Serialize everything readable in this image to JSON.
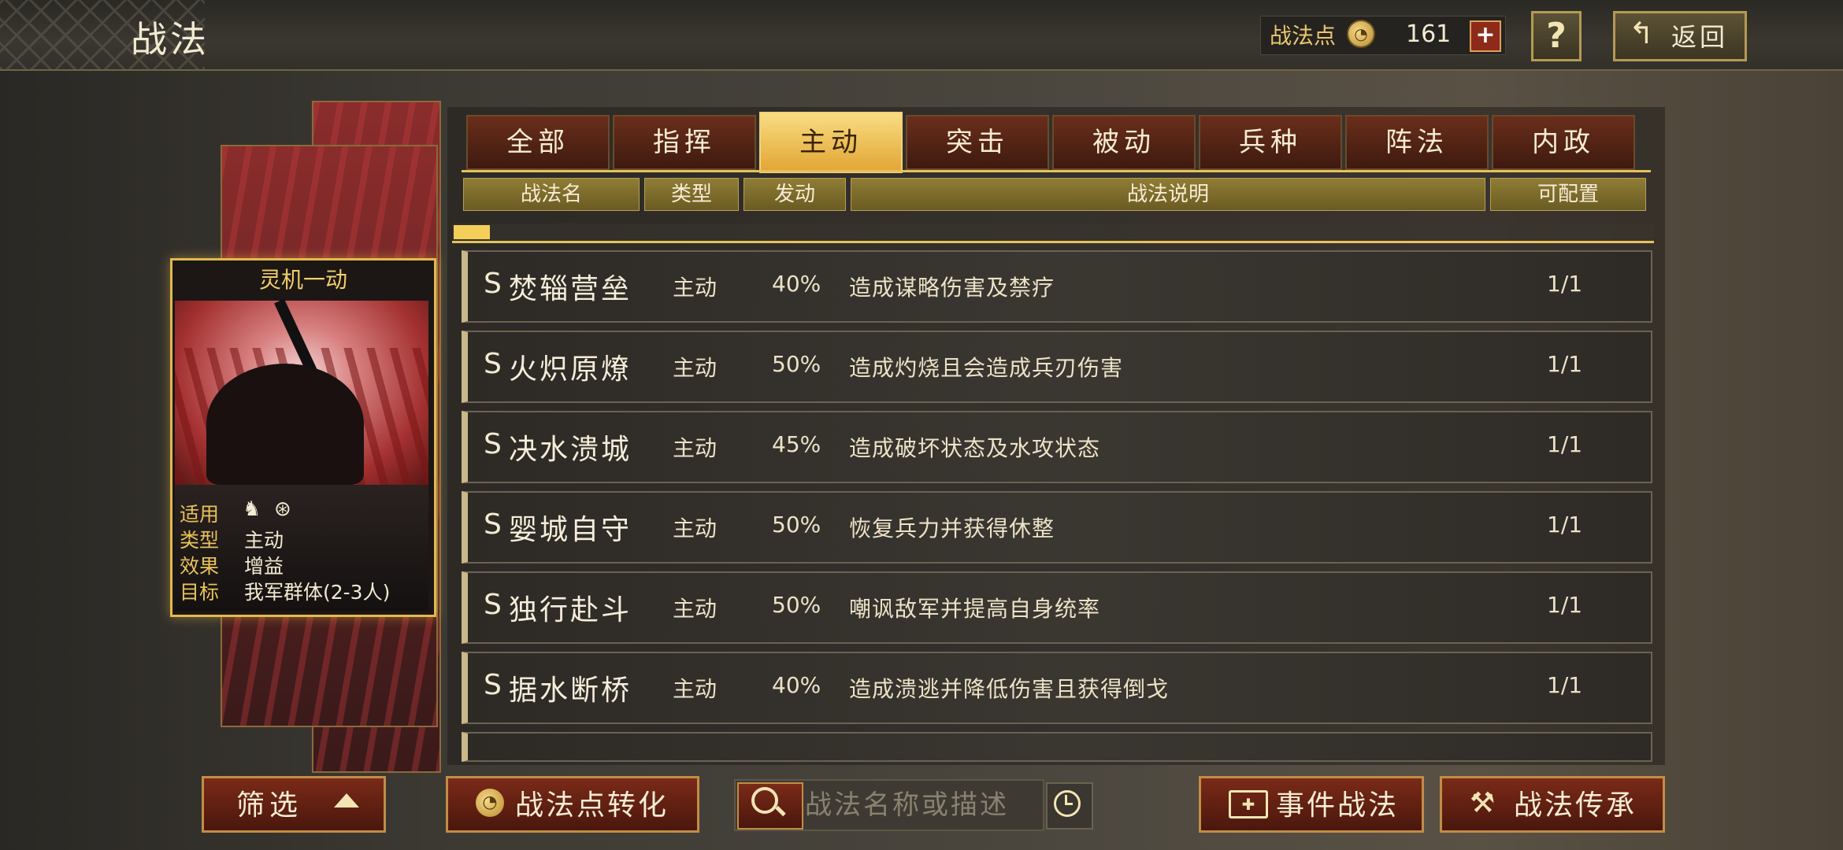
{
  "header": {
    "title": "战法",
    "points_label": "战法点",
    "points_value": "161",
    "plus_label": "+",
    "help_label": "?",
    "back_label": "返回"
  },
  "tabs": [
    {
      "label": "全部",
      "active": false
    },
    {
      "label": "指挥",
      "active": false
    },
    {
      "label": "主动",
      "active": true
    },
    {
      "label": "突击",
      "active": false
    },
    {
      "label": "被动",
      "active": false
    },
    {
      "label": "兵种",
      "active": false
    },
    {
      "label": "阵法",
      "active": false
    },
    {
      "label": "内政",
      "active": false
    }
  ],
  "columns": {
    "name": "战法名",
    "type": "类型",
    "trigger": "发动",
    "desc": "战法说明",
    "config": "可配置"
  },
  "list_scroll_progress": 0.03,
  "rows": [
    {
      "grade": "S",
      "name": "焚辎营垒",
      "type": "主动",
      "rate": "40%",
      "desc": "造成谋略伤害及禁疗",
      "count": "1/1"
    },
    {
      "grade": "S",
      "name": "火炽原燎",
      "type": "主动",
      "rate": "50%",
      "desc": "造成灼烧且会造成兵刃伤害",
      "count": "1/1"
    },
    {
      "grade": "S",
      "name": "决水溃城",
      "type": "主动",
      "rate": "45%",
      "desc": "造成破坏状态及水攻状态",
      "count": "1/1"
    },
    {
      "grade": "S",
      "name": "婴城自守",
      "type": "主动",
      "rate": "50%",
      "desc": "恢复兵力并获得休整",
      "count": "1/1"
    },
    {
      "grade": "S",
      "name": "独行赴斗",
      "type": "主动",
      "rate": "50%",
      "desc": "嘲讽敌军并提高自身统率",
      "count": "1/1"
    },
    {
      "grade": "S",
      "name": "据水断桥",
      "type": "主动",
      "rate": "40%",
      "desc": "造成溃逃并降低伤害且获得倒戈",
      "count": "1/1"
    }
  ],
  "card": {
    "title": "灵机一动",
    "apply_label": "适用",
    "apply_icons": [
      "cavalry-icon",
      "shield-icon"
    ],
    "type_label": "类型",
    "type_value": "主动",
    "effect_label": "效果",
    "effect_value": "增益",
    "target_label": "目标",
    "target_value": "我军群体(2-3人)"
  },
  "bottom": {
    "filter_label": "筛选",
    "convert_label": "战法点转化",
    "search_placeholder": "战法名称或描述",
    "event_label": "事件战法",
    "inherit_label": "战法传承"
  },
  "colors": {
    "accent_gold": "#e6c25c",
    "active_tab": "#f4cf5a",
    "button_red": "#7a2a18"
  }
}
